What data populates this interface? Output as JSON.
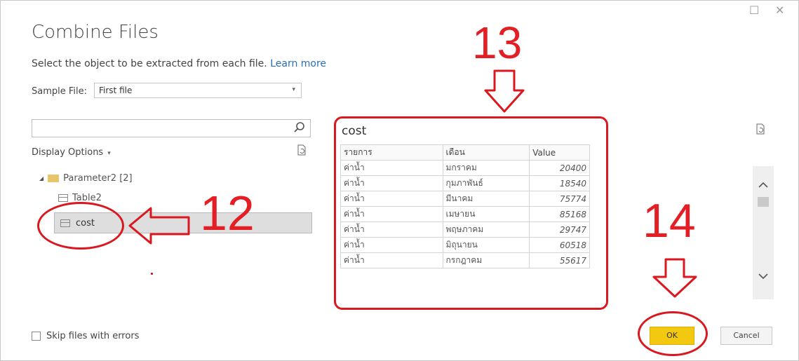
{
  "window": {
    "maximize_glyph": "☐",
    "close_glyph": "✕"
  },
  "dialog": {
    "title": "Combine Files",
    "subtitle": "Select the object to be extracted from each file.",
    "learn_more": "Learn more",
    "sample_file_label": "Sample File:",
    "sample_file_value": "First file",
    "search_placeholder": "",
    "display_options_label": "Display Options"
  },
  "tree": {
    "parameter_label": "Parameter2 [2]",
    "table2_label": "Table2",
    "cost_label": "cost"
  },
  "preview": {
    "title": "cost",
    "columns": [
      "รายการ",
      "เดือน",
      "Value"
    ],
    "rows": [
      [
        "ค่าน้ำ",
        "มกราคม",
        "20400"
      ],
      [
        "ค่าน้ำ",
        "กุมภาพันธ์",
        "18540"
      ],
      [
        "ค่าน้ำ",
        "มีนาคม",
        "75774"
      ],
      [
        "ค่าน้ำ",
        "เมษายน",
        "85168"
      ],
      [
        "ค่าน้ำ",
        "พฤษภาคม",
        "29747"
      ],
      [
        "ค่าน้ำ",
        "มิถุนายน",
        "60518"
      ],
      [
        "ค่าน้ำ",
        "กรกฎาคม",
        "55617"
      ]
    ]
  },
  "skip_errors_label": "Skip files with errors",
  "buttons": {
    "ok": "OK",
    "cancel": "Cancel"
  },
  "annotations": {
    "step_12": "12",
    "step_13": "13",
    "step_14": "14",
    "color": "#e31e24"
  },
  "icons": [
    "search-icon",
    "refresh-icon",
    "folder-icon",
    "table-icon",
    "chevron-up-icon",
    "chevron-down-icon"
  ]
}
